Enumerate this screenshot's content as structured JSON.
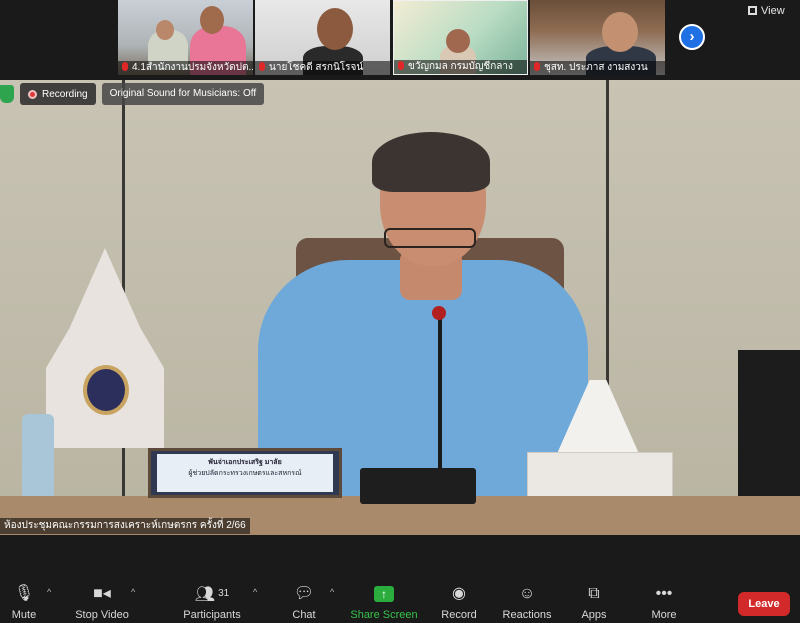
{
  "participants_strip": {
    "tiles": [
      {
        "name": "4.1สำนักงานปรมจังหวัดปต..."
      },
      {
        "name": "นายโชคดี สรกนิโรจน์"
      },
      {
        "name": "ขวัญกมล กรมบัญชีกลาง"
      },
      {
        "name": "ชุสท. ประภาส งามสงวน"
      }
    ],
    "view_label": "View"
  },
  "recording": {
    "label": "Recording",
    "original_sound": "Original Sound for Musicians: Off"
  },
  "video": {
    "nameplate_line1": "พันจ่าเอกประเสริฐ มาลัย",
    "nameplate_line2": "ผู้ช่วยปลัดกระทรวงเกษตรและสหกรณ์",
    "caption": "ห้องประชุมคณะกรรมการสงเคราะห์เกษตรกร ครั้งที่ 2/66"
  },
  "toolbar": {
    "mute": "Mute",
    "stop_video": "Stop Video",
    "participants": "Participants",
    "participants_count": "31",
    "chat": "Chat",
    "share_screen": "Share Screen",
    "record": "Record",
    "reactions": "Reactions",
    "apps": "Apps",
    "more": "More",
    "leave": "Leave"
  },
  "colors": {
    "share_green": "#2aad3c",
    "leave_red": "#d22a2a",
    "record_red": "#e03b3b",
    "next_blue": "#1f6fe5"
  }
}
